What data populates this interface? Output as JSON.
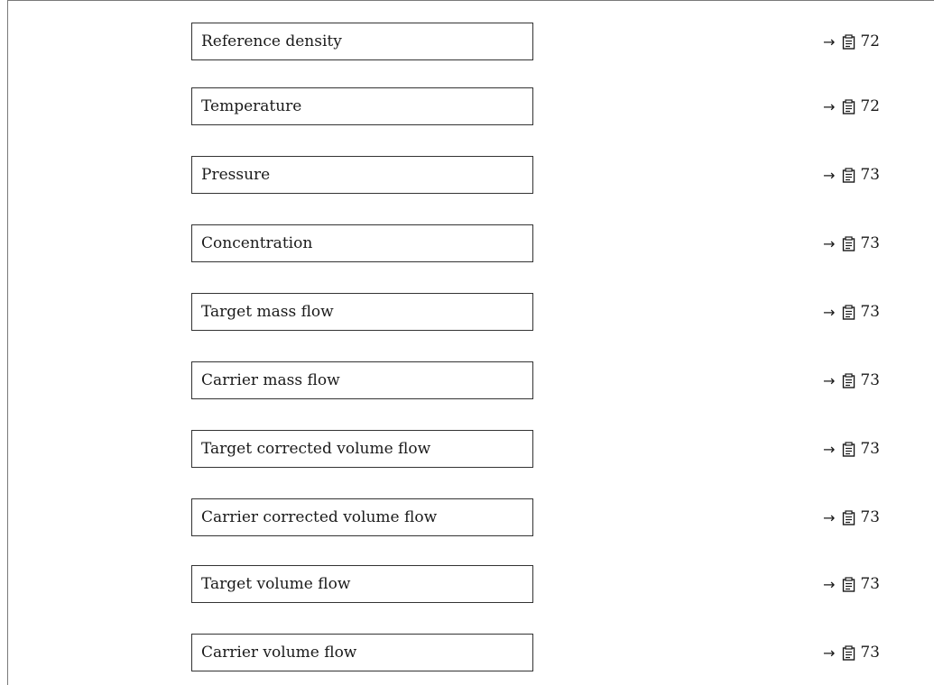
{
  "parameters": [
    {
      "label": "Reference density",
      "page": "72"
    },
    {
      "label": "Temperature",
      "page": "72"
    },
    {
      "label": "Pressure",
      "page": "73"
    },
    {
      "label": "Concentration",
      "page": "73"
    },
    {
      "label": "Target mass flow",
      "page": "73"
    },
    {
      "label": "Carrier mass flow",
      "page": "73"
    },
    {
      "label": "Target corrected volume flow",
      "page": "73"
    },
    {
      "label": "Carrier corrected volume flow",
      "page": "73"
    },
    {
      "label": "Target volume flow",
      "page": "73"
    },
    {
      "label": "Carrier volume flow",
      "page": "73"
    }
  ],
  "icons": {
    "arrow": "right-arrow-icon",
    "page": "page-reference-icon"
  },
  "colors": {
    "border": "#333333",
    "frame": "#7a7a7a",
    "text": "#1a1a1a"
  }
}
